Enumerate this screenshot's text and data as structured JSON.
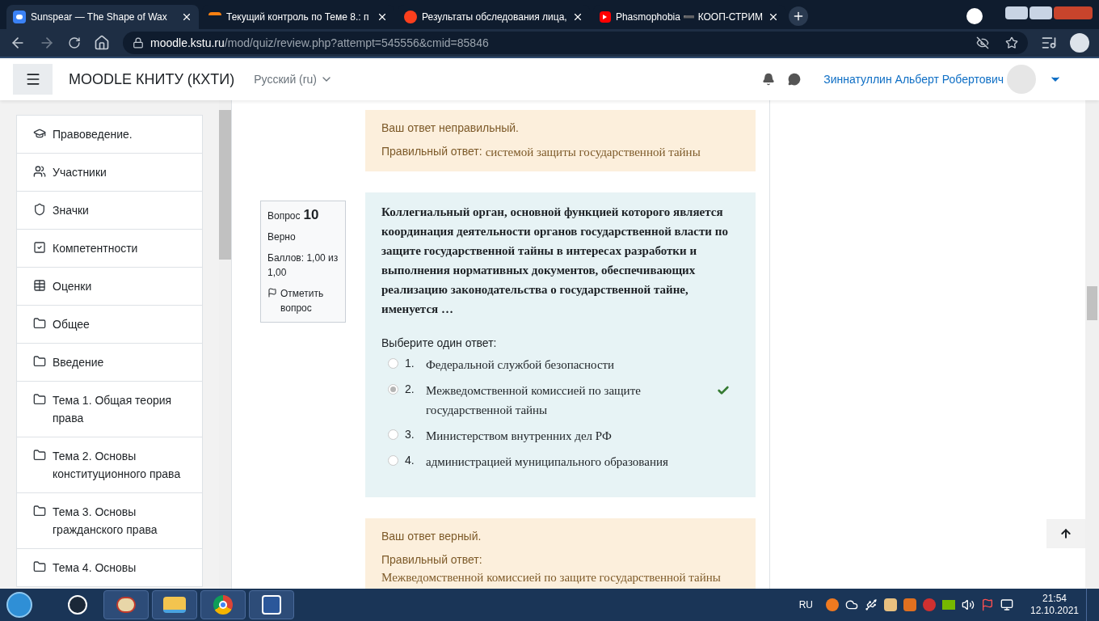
{
  "browser": {
    "tabs": [
      {
        "title": "Sunspear — The Shape of Wax",
        "kind": "chat",
        "selected": true
      },
      {
        "title": "Текущий контроль по Теме 8.: п",
        "kind": "moodle",
        "selected": false
      },
      {
        "title": "Результаты обследования лица,",
        "kind": "yandex",
        "selected": false
      },
      {
        "title": "Phasmophobia ➖ КООП-СТРИМ",
        "kind": "video",
        "selected": false
      }
    ],
    "address": {
      "domain": "moodle.kstu.ru",
      "path": "/mod/quiz/review.php?attempt=545556&cmid=85846"
    }
  },
  "navbar": {
    "site_name": "MOODLE КНИТУ (КХТИ)",
    "language": "Русский (ru)",
    "user_name": "Зиннатуллин Альберт Робертович"
  },
  "sidebar": {
    "items": [
      {
        "label": "Правоведение.",
        "kind": "course"
      },
      {
        "label": "Участники",
        "kind": "participants"
      },
      {
        "label": "Значки",
        "kind": "badges"
      },
      {
        "label": "Компетентности",
        "kind": "competencies"
      },
      {
        "label": "Оценки",
        "kind": "grades"
      },
      {
        "label": "Общее",
        "kind": "section"
      },
      {
        "label": "Введение",
        "kind": "section"
      },
      {
        "label": "Тема 1. Общая теория права",
        "kind": "section"
      },
      {
        "label": "Тема 2. Основы конституционного права",
        "kind": "section"
      },
      {
        "label": "Тема 3. Основы гражданского права",
        "kind": "section"
      },
      {
        "label": "Тема 4. Основы",
        "kind": "section"
      }
    ]
  },
  "feedback_top": {
    "verdict": "Ваш ответ неправильный.",
    "answer_label": "Правильный ответ:",
    "answer": "системой защиты государственной тайны"
  },
  "question": {
    "info": {
      "label": "Вопрос",
      "number": "10",
      "status": "Верно",
      "score": "Баллов: 1,00 из 1,00",
      "flag": "Отметить вопрос"
    },
    "text": "Коллегиальный орган, основной функцией которого является координация деятельности органов государственной власти по защите государственной тайны в интересах разработки и выполнения  нормативных документов, обеспечивающих реализацию законодательства о государственной тайне, именуется …",
    "prompt": "Выберите один ответ:",
    "options": [
      {
        "number": "1.",
        "text": "Федеральной службой безопасности",
        "selected": false,
        "correct": false
      },
      {
        "number": "2.",
        "text": "Межведомственной комиссией по защите государственной тайны",
        "selected": true,
        "correct": true
      },
      {
        "number": "3.",
        "text": "Министерством внутренних дел РФ",
        "selected": false,
        "correct": false
      },
      {
        "number": "4.",
        "text": "администрацией муниципального образования",
        "selected": false,
        "correct": false
      }
    ]
  },
  "feedback_bottom": {
    "verdict": "Ваш ответ верный.",
    "answer_label": "Правильный ответ:",
    "answer": "Межведомственной комиссией по защите государственной тайны"
  },
  "taskbar": {
    "apps": [
      {
        "kind": "steam"
      },
      {
        "kind": "paint"
      },
      {
        "kind": "explorer"
      },
      {
        "kind": "chrome"
      },
      {
        "kind": "word"
      }
    ],
    "language": "RU",
    "time": "21:54",
    "date": "12.10.2021"
  }
}
